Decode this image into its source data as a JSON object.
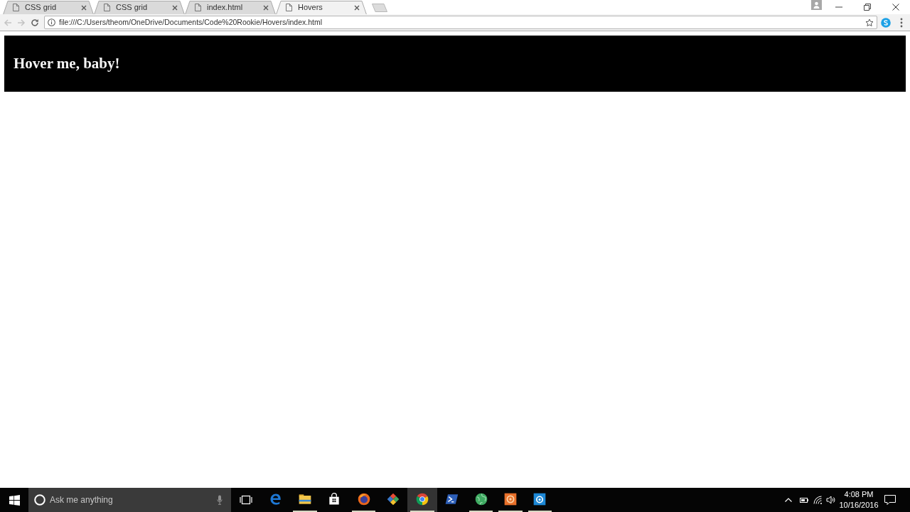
{
  "browser": {
    "tabs": [
      {
        "title": "CSS grid",
        "selected": false
      },
      {
        "title": "CSS grid",
        "selected": false
      },
      {
        "title": "index.html",
        "selected": false
      },
      {
        "title": "Hovers",
        "selected": true
      }
    ],
    "navigation": {
      "back": {
        "disabled": true
      },
      "forward": {
        "disabled": true
      }
    },
    "address_bar": {
      "url": "file:///C:/Users/theom/OneDrive/Documents/Code%20Rookie/Hovers/index.html"
    }
  },
  "page": {
    "heading": "Hover me, baby!"
  },
  "taskbar": {
    "search": {
      "placeholder": "Ask me anything"
    },
    "apps": [
      {
        "kind": "edge",
        "running": false,
        "selected": false
      },
      {
        "kind": "folder",
        "running": true,
        "selected": false
      },
      {
        "kind": "store",
        "running": false,
        "selected": false
      },
      {
        "kind": "firefox",
        "running": true,
        "selected": false
      },
      {
        "kind": "git",
        "running": false,
        "selected": false
      },
      {
        "kind": "chrome",
        "running": true,
        "selected": true
      },
      {
        "kind": "terminal",
        "running": false,
        "selected": false
      },
      {
        "kind": "globe",
        "running": true,
        "selected": false
      },
      {
        "kind": "ringtile",
        "running": true,
        "selected": false
      },
      {
        "kind": "lenstile",
        "running": true,
        "selected": false
      }
    ],
    "clock": {
      "time": "4:08 PM",
      "date": "10/16/2016"
    }
  }
}
